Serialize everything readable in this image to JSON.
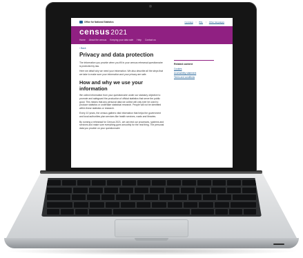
{
  "header": {
    "org": "Office for National Statistics",
    "links": [
      {
        "label": "Cymraeg"
      },
      {
        "label": "BSL"
      },
      {
        "label": "Other languages"
      }
    ]
  },
  "brand": {
    "name": "census",
    "year": "2021",
    "color": "#902082"
  },
  "nav": {
    "items": [
      "Home",
      "About the census",
      "Keeping your data safe",
      "Help",
      "Contact us"
    ]
  },
  "back_label": "Back",
  "page": {
    "title": "Privacy and data protection",
    "intro": [
      "The information you provide when you fill in your census rehearsal questionnaire is protected by law.",
      "Here we detail why we need your information. We also describe all the steps that we take to make sure your information and your privacy are safe."
    ],
    "section_title": "How and why we use your information",
    "section_body": [
      "We collect information from your questionnaire under our statutory objective to promote and safeguard the production of official statistics that serve the public good. This means that any personal data we collect will only ever be used to produce statistics or undertake statistical research. People will not be identified within these statistics or research.",
      "Every 10 years, the census gathers vital information that helps the government and local authorities plan services like health services, roads and libraries.",
      "By running a rehearsal for Census 2021, we can test our processes, systems and services and make sure everything goes smoothly for the real thing. The personal data you provide on your questionnaire"
    ]
  },
  "sidebar": {
    "heading": "Related content",
    "links": [
      "Cookies",
      "Accessibility statement",
      "Terms and conditions"
    ]
  }
}
